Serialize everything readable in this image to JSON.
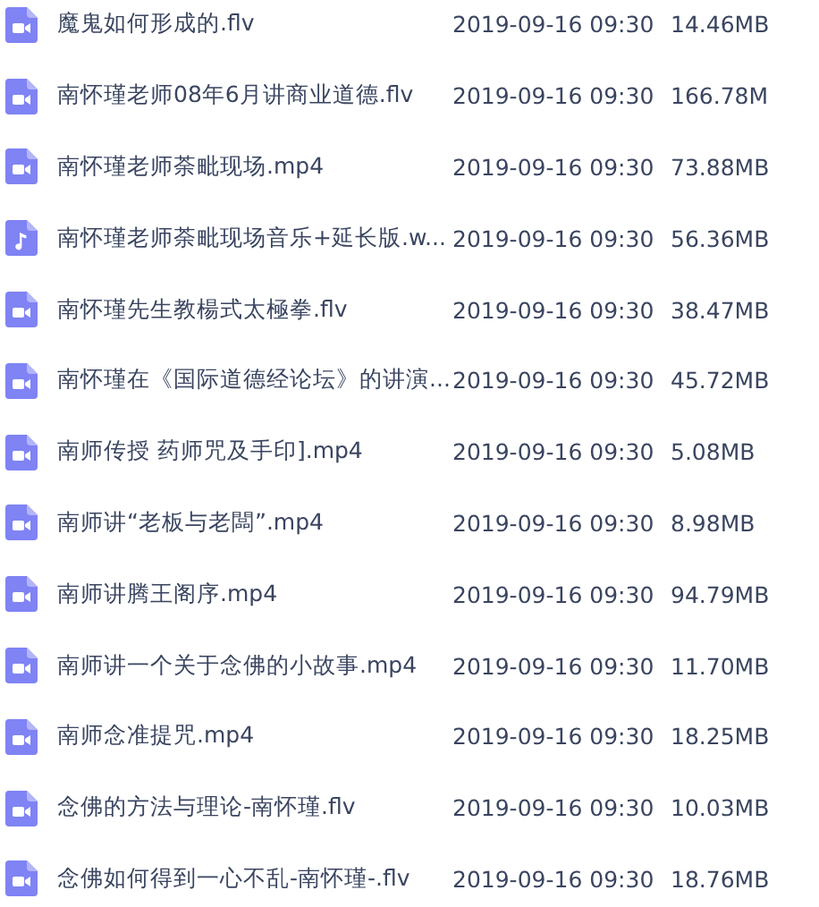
{
  "files": [
    {
      "kind": "video",
      "name": "魔鬼如何形成的.flv",
      "modified": "2019-09-16 09:30",
      "size": "14.46MB"
    },
    {
      "kind": "video",
      "name": "南怀瑾老师08年6月讲商业道德.flv",
      "modified": "2019-09-16 09:30",
      "size": "166.78M"
    },
    {
      "kind": "video",
      "name": "南怀瑾老师荼毗现场.mp4",
      "modified": "2019-09-16 09:30",
      "size": "73.88MB"
    },
    {
      "kind": "audio",
      "name": "南怀瑾老师荼毗现场音乐+延长版.w...",
      "modified": "2019-09-16 09:30",
      "size": "56.36MB"
    },
    {
      "kind": "video",
      "name": "南怀瑾先生教楊式太極拳.flv",
      "modified": "2019-09-16 09:30",
      "size": "38.47MB"
    },
    {
      "kind": "video",
      "name": "南怀瑾在《国际道德经论坛》的讲演...",
      "modified": "2019-09-16 09:30",
      "size": "45.72MB"
    },
    {
      "kind": "video",
      "name": "南师传授 药师咒及手印].mp4",
      "modified": "2019-09-16 09:30",
      "size": "5.08MB"
    },
    {
      "kind": "video",
      "name": "南师讲“老板与老闆”.mp4",
      "modified": "2019-09-16 09:30",
      "size": "8.98MB"
    },
    {
      "kind": "video",
      "name": "南师讲腾王阁序.mp4",
      "modified": "2019-09-16 09:30",
      "size": "94.79MB"
    },
    {
      "kind": "video",
      "name": "南师讲一个关于念佛的小故事.mp4",
      "modified": "2019-09-16 09:30",
      "size": "11.70MB"
    },
    {
      "kind": "video",
      "name": "南师念准提咒.mp4",
      "modified": "2019-09-16 09:30",
      "size": "18.25MB"
    },
    {
      "kind": "video",
      "name": "念佛的方法与理论-南怀瑾.flv",
      "modified": "2019-09-16 09:30",
      "size": "10.03MB"
    },
    {
      "kind": "video",
      "name": "念佛如何得到一心不乱-南怀瑾-.flv",
      "modified": "2019-09-16 09:30",
      "size": "18.76MB"
    }
  ]
}
